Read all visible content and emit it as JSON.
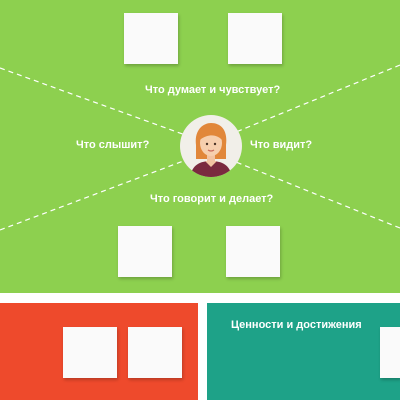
{
  "colors": {
    "map_background": "#8dd04f",
    "pains_panel": "#ee4a2c",
    "gains_panel": "#1ea288",
    "sticky_note": "#fafafa",
    "text": "#ffffff"
  },
  "map": {
    "think_feel": "Что думает и чувствует?",
    "hear": "Что слышит?",
    "see": "Что видит?",
    "say_do": "Что говорит и делает?"
  },
  "center_icon": "woman-persona-avatar",
  "panels": {
    "left_title": "",
    "right_title": "Ценности и достижения"
  }
}
